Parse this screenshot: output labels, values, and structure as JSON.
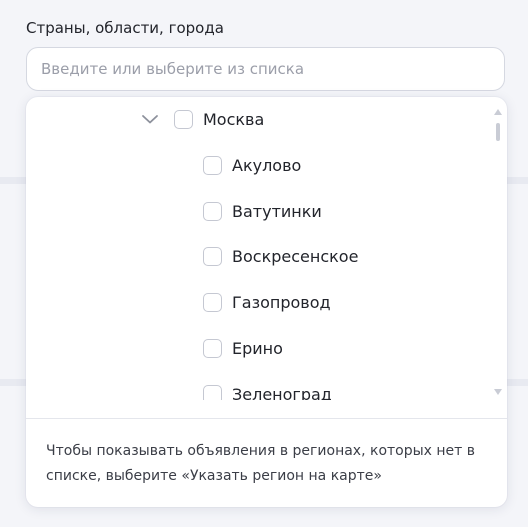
{
  "field": {
    "label": "Страны, области, города",
    "placeholder": "Введите или выберите из списка"
  },
  "dropdown": {
    "parent": {
      "label": "Москва",
      "expanded": true,
      "checked": false
    },
    "children": [
      {
        "label": "Акулово",
        "checked": false
      },
      {
        "label": "Ватутинки",
        "checked": false
      },
      {
        "label": "Воскресенское",
        "checked": false
      },
      {
        "label": "Газопровод",
        "checked": false
      },
      {
        "label": "Ерино",
        "checked": false
      },
      {
        "label": "Зеленоград",
        "checked": false
      }
    ],
    "hint": "Чтобы показывать объявления в регионах, которых нет в списке, выберите «Указать регион на карте»"
  },
  "icons": {
    "expand": "chevron-down-icon",
    "scroll_up": "scroll-up-arrow-icon",
    "scroll_down": "scroll-down-arrow-icon"
  },
  "colors": {
    "background": "#f4f5f9",
    "checkbox_border": "#c5c8d2",
    "text": "#22242b",
    "placeholder": "#9b9ea9"
  }
}
